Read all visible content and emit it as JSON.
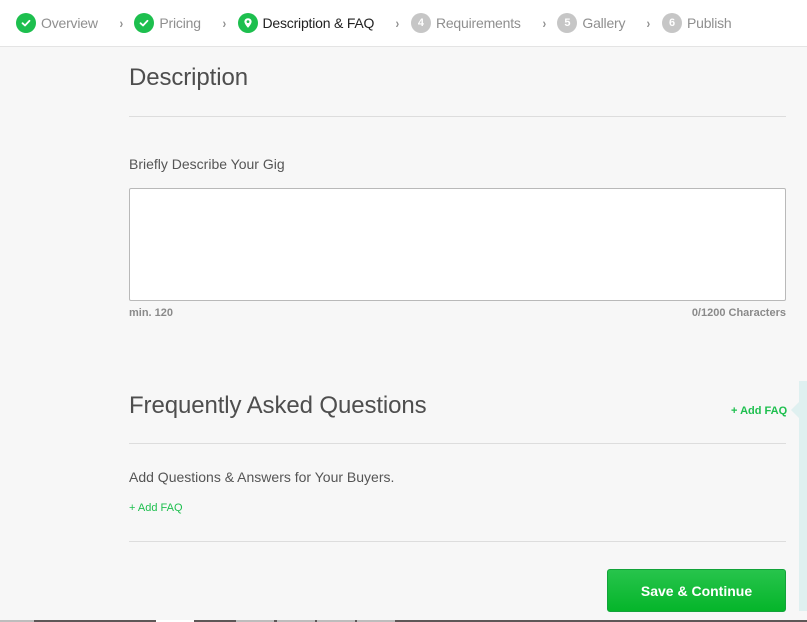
{
  "stepper": {
    "steps": [
      {
        "label": "Overview",
        "state": "done",
        "icon": "check-icon"
      },
      {
        "label": "Pricing",
        "state": "done",
        "icon": "check-icon"
      },
      {
        "label": "Description & FAQ",
        "state": "current",
        "icon": "location-pin-icon"
      },
      {
        "label": "Requirements",
        "state": "pending",
        "number": "4"
      },
      {
        "label": "Gallery",
        "state": "pending",
        "number": "5"
      },
      {
        "label": "Publish",
        "state": "pending",
        "number": "6"
      }
    ],
    "separator": "›"
  },
  "description": {
    "title": "Description",
    "field_label": "Briefly Describe Your Gig",
    "value": "",
    "min_hint": "min. 120",
    "char_count": "0/1200 Characters"
  },
  "faq": {
    "title": "Frequently Asked Questions",
    "add_faq_header": "+ Add FAQ",
    "prompt": "Add Questions & Answers for Your Buyers.",
    "add_faq_inline": "+ Add FAQ"
  },
  "actions": {
    "save_continue": "Save & Continue"
  },
  "colors": {
    "accent": "#1dbf4e",
    "pending": "#c6c6c6"
  }
}
